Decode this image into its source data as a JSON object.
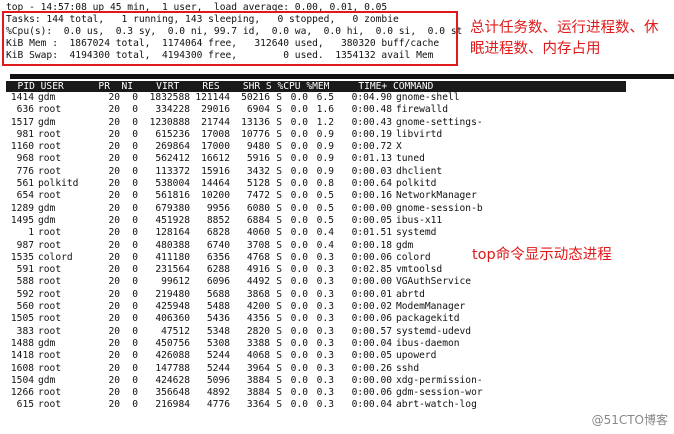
{
  "header_lines": [
    "top - 14:57:08 up 45 min,  1 user,  load average: 0.00, 0.01, 0.05",
    "Tasks: 144 total,   1 running, 143 sleeping,   0 stopped,   0 zombie",
    "%Cpu(s):  0.0 us,  0.3 sy,  0.0 ni, 99.7 id,  0.0 wa,  0.0 hi,  0.0 si,  0.0 st",
    "KiB Mem :  1867024 total,  1174064 free,   312640 used,   380320 buff/cache",
    "KiB Swap:  4194300 total,  4194300 free,        0 used.  1354132 avail Mem"
  ],
  "annotations": {
    "summary_note": "总计任务数、运行进程数、休眠进程数、内存占用",
    "top_note": "top命令显示动态进程"
  },
  "table": {
    "header": "  PID USER      PR  NI    VIRT    RES    SHR S %CPU %MEM     TIME+ COMMAND",
    "rows": [
      [
        "1414",
        "gdm",
        "20",
        "0",
        "1832588",
        "121144",
        "50216",
        "S",
        "0.0",
        "6.5",
        "0:04.90",
        "gnome-shell"
      ],
      [
        "636",
        "root",
        "20",
        "0",
        "334228",
        "29016",
        "6904",
        "S",
        "0.0",
        "1.6",
        "0:00.48",
        "firewalld"
      ],
      [
        "1517",
        "gdm",
        "20",
        "0",
        "1230888",
        "21744",
        "13136",
        "S",
        "0.0",
        "1.2",
        "0:00.43",
        "gnome-settings-"
      ],
      [
        "981",
        "root",
        "20",
        "0",
        "615236",
        "17008",
        "10776",
        "S",
        "0.0",
        "0.9",
        "0:00.19",
        "libvirtd"
      ],
      [
        "1160",
        "root",
        "20",
        "0",
        "269864",
        "17000",
        "9480",
        "S",
        "0.0",
        "0.9",
        "0:00.72",
        "X"
      ],
      [
        "968",
        "root",
        "20",
        "0",
        "562412",
        "16612",
        "5916",
        "S",
        "0.0",
        "0.9",
        "0:01.13",
        "tuned"
      ],
      [
        "776",
        "root",
        "20",
        "0",
        "113372",
        "15916",
        "3432",
        "S",
        "0.0",
        "0.9",
        "0:00.03",
        "dhclient"
      ],
      [
        "561",
        "polkitd",
        "20",
        "0",
        "538004",
        "14464",
        "5128",
        "S",
        "0.0",
        "0.8",
        "0:00.64",
        "polkitd"
      ],
      [
        "654",
        "root",
        "20",
        "0",
        "561816",
        "10200",
        "7472",
        "S",
        "0.0",
        "0.5",
        "0:00.16",
        "NetworkManager"
      ],
      [
        "1289",
        "gdm",
        "20",
        "0",
        "679380",
        "9956",
        "6080",
        "S",
        "0.0",
        "0.5",
        "0:00.00",
        "gnome-session-b"
      ],
      [
        "1495",
        "gdm",
        "20",
        "0",
        "451928",
        "8852",
        "6884",
        "S",
        "0.0",
        "0.5",
        "0:00.05",
        "ibus-x11"
      ],
      [
        "1",
        "root",
        "20",
        "0",
        "128164",
        "6828",
        "4060",
        "S",
        "0.0",
        "0.4",
        "0:01.51",
        "systemd"
      ],
      [
        "987",
        "root",
        "20",
        "0",
        "480388",
        "6740",
        "3708",
        "S",
        "0.0",
        "0.4",
        "0:00.18",
        "gdm"
      ],
      [
        "1535",
        "colord",
        "20",
        "0",
        "411180",
        "6356",
        "4768",
        "S",
        "0.0",
        "0.3",
        "0:00.06",
        "colord"
      ],
      [
        "591",
        "root",
        "20",
        "0",
        "231564",
        "6288",
        "4916",
        "S",
        "0.0",
        "0.3",
        "0:02.85",
        "vmtoolsd"
      ],
      [
        "588",
        "root",
        "20",
        "0",
        "99612",
        "6096",
        "4492",
        "S",
        "0.0",
        "0.3",
        "0:00.00",
        "VGAuthService"
      ],
      [
        "592",
        "root",
        "20",
        "0",
        "219480",
        "5688",
        "3868",
        "S",
        "0.0",
        "0.3",
        "0:00.01",
        "abrtd"
      ],
      [
        "560",
        "root",
        "20",
        "0",
        "425948",
        "5488",
        "4200",
        "S",
        "0.0",
        "0.3",
        "0:00.02",
        "ModemManager"
      ],
      [
        "1505",
        "root",
        "20",
        "0",
        "406360",
        "5436",
        "4356",
        "S",
        "0.0",
        "0.3",
        "0:00.06",
        "packagekitd"
      ],
      [
        "383",
        "root",
        "20",
        "0",
        "47512",
        "5348",
        "2820",
        "S",
        "0.0",
        "0.3",
        "0:00.57",
        "systemd-udevd"
      ],
      [
        "1488",
        "gdm",
        "20",
        "0",
        "450756",
        "5308",
        "3388",
        "S",
        "0.0",
        "0.3",
        "0:00.04",
        "ibus-daemon"
      ],
      [
        "1418",
        "root",
        "20",
        "0",
        "426088",
        "5244",
        "4068",
        "S",
        "0.0",
        "0.3",
        "0:00.05",
        "upowerd"
      ],
      [
        "1608",
        "root",
        "20",
        "0",
        "147788",
        "5244",
        "3964",
        "S",
        "0.0",
        "0.3",
        "0:00.26",
        "sshd"
      ],
      [
        "1504",
        "gdm",
        "20",
        "0",
        "424628",
        "5096",
        "3884",
        "S",
        "0.0",
        "0.3",
        "0:00.00",
        "xdg-permission-"
      ],
      [
        "1266",
        "root",
        "20",
        "0",
        "356648",
        "4892",
        "3884",
        "S",
        "0.0",
        "0.3",
        "0:00.06",
        "gdm-session-wor"
      ],
      [
        "615",
        "root",
        "20",
        "0",
        "216984",
        "4776",
        "3364",
        "S",
        "0.0",
        "0.3",
        "0:00.04",
        "abrt-watch-log"
      ]
    ]
  },
  "watermark": "@51CTO博客"
}
